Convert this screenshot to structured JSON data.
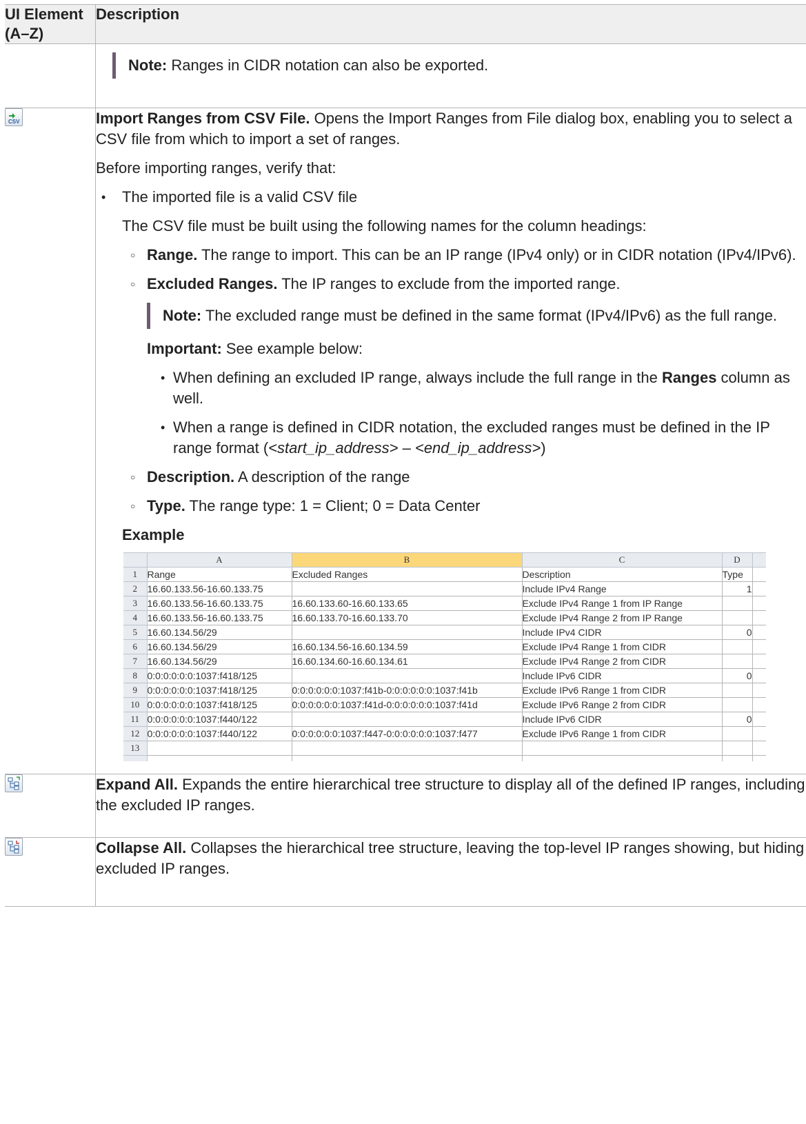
{
  "header": {
    "ui_element": "UI Element (A–Z)",
    "description": "Description"
  },
  "row_note": {
    "label": "Note:",
    "text": " Ranges in CIDR notation can also be exported."
  },
  "import": {
    "title": "Import Ranges from CSV File.",
    "title_rest": " Opens the Import Ranges from File dialog box, enabling you to select a CSV file from which to import a set of ranges.",
    "before": "Before importing ranges, verify that:",
    "bullet1": "The imported file is a valid CSV file",
    "csv_intro": "The CSV file must be built using the following names for the column headings:",
    "range_label": "Range.",
    "range_text": " The range to import. This can be an IP range (IPv4 only) or in CIDR notation (IPv4/IPv6).",
    "excluded_label": "Excluded Ranges.",
    "excluded_text": " The IP ranges to exclude from the imported range.",
    "note_label": "Note:",
    "note_text": " The excluded range must be defined in the same format (IPv4/IPv6) as the full range.",
    "important_label": "Important:",
    "important_text": " See example below:",
    "sub1_a": "When defining an excluded IP range, always include the full range in the ",
    "sub1_b": "Ranges",
    "sub1_c": " column as well.",
    "sub2_a": "When a range is defined in CIDR notation, the excluded ranges must be defined in the IP range format (",
    "sub2_b": "<start_ip_address> – <end_ip_address>",
    "sub2_c": ")",
    "desc_label": "Description.",
    "desc_text": " A description of the range",
    "type_label": "Type.",
    "type_text": " The range type: 1 = Client; 0 = Data Center",
    "example_heading": "Example"
  },
  "spreadsheet": {
    "columns": [
      "A",
      "B",
      "C",
      "D"
    ],
    "rows": [
      {
        "n": "1",
        "a": "Range",
        "b": "Excluded Ranges",
        "c": "Description",
        "d": "Type"
      },
      {
        "n": "2",
        "a": "16.60.133.56-16.60.133.75",
        "b": "",
        "c": "Include IPv4 Range",
        "d": "1"
      },
      {
        "n": "3",
        "a": "16.60.133.56-16.60.133.75",
        "b": "16.60.133.60-16.60.133.65",
        "c": "Exclude IPv4 Range 1 from IP Range",
        "d": ""
      },
      {
        "n": "4",
        "a": "16.60.133.56-16.60.133.75",
        "b": "16.60.133.70-16.60.133.70",
        "c": "Exclude IPv4 Range 2 from IP Range",
        "d": ""
      },
      {
        "n": "5",
        "a": "16.60.134.56/29",
        "b": "",
        "c": "Include IPv4 CIDR",
        "d": "0"
      },
      {
        "n": "6",
        "a": "16.60.134.56/29",
        "b": "16.60.134.56-16.60.134.59",
        "c": "Exclude IPv4 Range 1 from CIDR",
        "d": ""
      },
      {
        "n": "7",
        "a": "16.60.134.56/29",
        "b": "16.60.134.60-16.60.134.61",
        "c": "Exclude IPv4 Range 2 from CIDR",
        "d": ""
      },
      {
        "n": "8",
        "a": "0:0:0:0:0:0:1037:f418/125",
        "b": "",
        "c": "Include IPv6 CIDR",
        "d": "0"
      },
      {
        "n": "9",
        "a": "0:0:0:0:0:0:1037:f418/125",
        "b": "0:0:0:0:0:0:1037:f41b-0:0:0:0:0:0:1037:f41b",
        "c": "Exclude IPv6 Range 1 from CIDR",
        "d": ""
      },
      {
        "n": "10",
        "a": "0:0:0:0:0:0:1037:f418/125",
        "b": "0:0:0:0:0:0:1037:f41d-0:0:0:0:0:0:1037:f41d",
        "c": "Exclude IPv6 Range 2 from CIDR",
        "d": ""
      },
      {
        "n": "11",
        "a": "0:0:0:0:0:0:1037:f440/122",
        "b": "",
        "c": "Include IPv6 CIDR",
        "d": "0"
      },
      {
        "n": "12",
        "a": "0:0:0:0:0:0:1037:f440/122",
        "b": "0:0:0:0:0:0:1037:f447-0:0:0:0:0:0:1037:f477",
        "c": "Exclude IPv6 Range 1 from CIDR",
        "d": ""
      },
      {
        "n": "13",
        "a": "",
        "b": "",
        "c": "",
        "d": ""
      }
    ]
  },
  "expand": {
    "title": "Expand All.",
    "text": " Expands the entire hierarchical tree structure to display all of the defined IP ranges, including the excluded IP ranges."
  },
  "collapse": {
    "title": "Collapse All.",
    "text": " Collapses the hierarchical tree structure, leaving the top-level IP ranges showing, but hiding excluded IP ranges."
  },
  "icons": {
    "import": "import-csv-icon",
    "expand": "expand-all-icon",
    "collapse": "collapse-all-icon"
  }
}
